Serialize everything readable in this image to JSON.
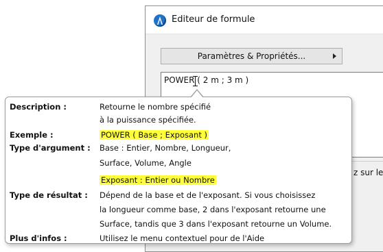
{
  "window": {
    "title": "Editeur de formule",
    "params_button": "Paramètres & Propriétés...",
    "formula_text": "POWER ( 2 m ; 3 m )",
    "hint_fragment": "z sur le"
  },
  "tooltip": {
    "description_label": "Description :",
    "description_lines": [
      "Retourne le nombre spécifié",
      "à la puissance spécifiée."
    ],
    "example_label": "Exemple :",
    "example_text": "POWER ( Base ; Exposant )",
    "arg_type_label": "Type d'argument :",
    "arg_type_lines": [
      "Base : Entier, Nombre, Longueur,",
      "Surface, Volume, Angle",
      "Exposant : Entier ou Nombre"
    ],
    "result_type_label": "Type de résultat :",
    "result_type_lines": [
      "Dépend de la base et de l'exposant. Si vous choisissez",
      "la longueur comme base, 2 dans l'exposant retourne une",
      "Surface, tandis que 3 dans l'exposant retourne un Volume."
    ],
    "more_info_label": "Plus d'infos :",
    "more_info_text": "Utilisez le menu contextuel pour de l'Aide"
  },
  "colors": {
    "highlight": "#ffff3a",
    "icon_blue": "#1e73c8"
  }
}
